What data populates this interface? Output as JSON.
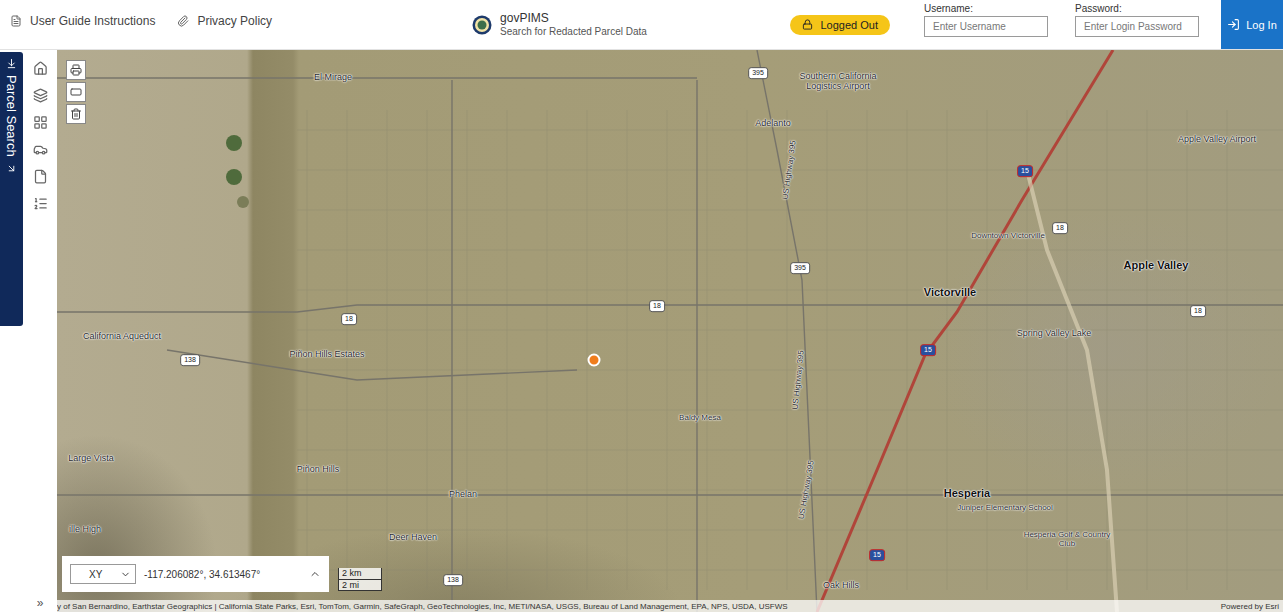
{
  "header": {
    "links": [
      {
        "label": "User Guide Instructions"
      },
      {
        "label": "Privacy Policy"
      }
    ],
    "app": {
      "title": "govPIMS",
      "subtitle": "Search for Redacted Parcel Data"
    },
    "status": {
      "label": "Logged Out",
      "logged_in": false
    },
    "login": {
      "username": {
        "label": "Username:",
        "placeholder": "Enter Username"
      },
      "password": {
        "label": "Password:",
        "placeholder": "Enter Login Password"
      },
      "button": "Log In"
    }
  },
  "side_tab": {
    "label": "Parcel Search"
  },
  "rail": {
    "expand": "»"
  },
  "map": {
    "labels": [
      {
        "text": "El Mirage",
        "kind": "place"
      },
      {
        "text": "Adelanto",
        "kind": "place"
      },
      {
        "text": "Southern California Logistics Airport",
        "kind": "place"
      },
      {
        "text": "Apple Valley Airport",
        "kind": "place"
      },
      {
        "text": "Downtown Victorville",
        "kind": "small"
      },
      {
        "text": "Victorville",
        "kind": "town"
      },
      {
        "text": "Apple Valley",
        "kind": "town"
      },
      {
        "text": "Spring Valley Lake",
        "kind": "place"
      },
      {
        "text": "Piñon Hills Estates",
        "kind": "place"
      },
      {
        "text": "California Aqueduct",
        "kind": "place"
      },
      {
        "text": "Baldy Mesa",
        "kind": "small"
      },
      {
        "text": "Large Vista",
        "kind": "place"
      },
      {
        "text": "Piñon Hills",
        "kind": "place"
      },
      {
        "text": "Phelan",
        "kind": "place"
      },
      {
        "text": "Hesperia",
        "kind": "town"
      },
      {
        "text": "Juniper Elementary School",
        "kind": "small"
      },
      {
        "text": "Hesperia Golf & Country Club",
        "kind": "small"
      },
      {
        "text": "Deer Haven",
        "kind": "place"
      },
      {
        "text": "ille High",
        "kind": "place"
      },
      {
        "text": "Oak Hills",
        "kind": "place"
      },
      {
        "text": "US Highway 395",
        "kind": "road"
      },
      {
        "text": "US Highway 395",
        "kind": "road"
      },
      {
        "text": "US Highway 395",
        "kind": "road"
      },
      {
        "text": "395",
        "kind": "shield"
      },
      {
        "text": "395",
        "kind": "shield"
      },
      {
        "text": "18",
        "kind": "shield"
      },
      {
        "text": "18",
        "kind": "shield"
      },
      {
        "text": "18",
        "kind": "shield"
      },
      {
        "text": "18",
        "kind": "shield"
      },
      {
        "text": "15",
        "kind": "interstate"
      },
      {
        "text": "15",
        "kind": "interstate"
      },
      {
        "text": "15",
        "kind": "interstate"
      },
      {
        "text": "138",
        "kind": "shield"
      },
      {
        "text": "138",
        "kind": "shield"
      }
    ],
    "coordinates": {
      "system": "XY",
      "value": "-117.206082°, 34.613467°"
    },
    "scale": [
      "2 km",
      "2 mi"
    ],
    "attribution": "y of San Bernardino, Earthstar Geographics | California State Parks, Esri, TomTom, Garmin, SafeGraph, GeoTechnologies, Inc, METI/NASA, USGS, Bureau of Land Management, EPA, NPS, USDA, USFWS",
    "powered_by": "Powered by Esri"
  }
}
